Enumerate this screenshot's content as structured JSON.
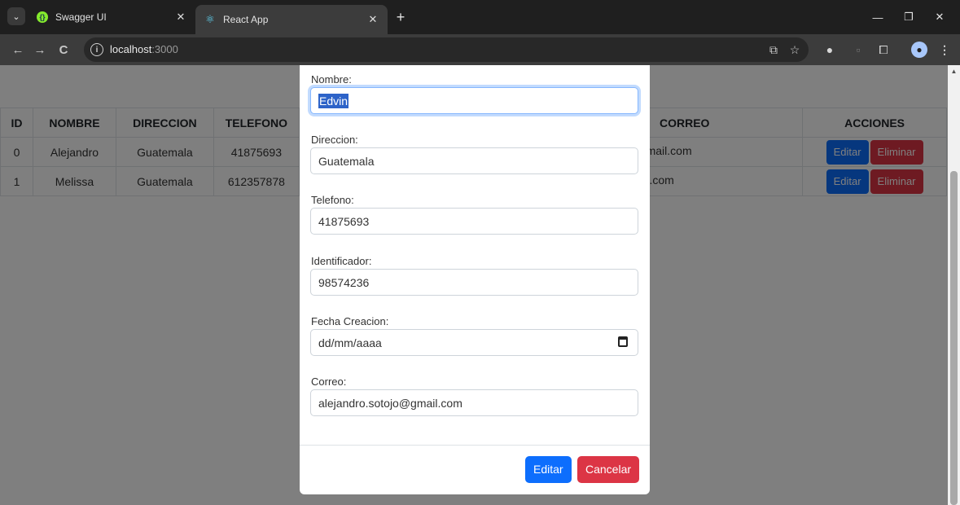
{
  "browser": {
    "tabs": [
      {
        "title": "Swagger UI",
        "icon": "swagger-icon",
        "active": false
      },
      {
        "title": "React App",
        "icon": "react-icon",
        "active": true
      }
    ],
    "url_host": "localhost",
    "url_port": ":3000"
  },
  "table": {
    "headers": [
      "ID",
      "NOMBRE",
      "DIRECCION",
      "TELEFONO",
      "",
      "CORREO",
      "ACCIONES"
    ],
    "rows": [
      {
        "id": "0",
        "nombre": "Alejandro",
        "direccion": "Guatemala",
        "telefono": "41875693",
        "correo": "ndro.sotojo@gmail.com"
      },
      {
        "id": "1",
        "nombre": "Melissa",
        "direccion": "Guatemala",
        "telefono": "612357878",
        "correo": "melissa@gmail.com"
      }
    ],
    "edit_label": "Editar",
    "delete_label": "Eliminar"
  },
  "modal": {
    "fields": [
      {
        "label": "Nombre:",
        "value": "Edvin"
      },
      {
        "label": "Direccion:",
        "value": "Guatemala"
      },
      {
        "label": "Telefono:",
        "value": "41875693"
      },
      {
        "label": "Identificador:",
        "value": "98574236"
      },
      {
        "label": "Fecha Creacion:",
        "value": "dd/mm/aaaa"
      },
      {
        "label": "Correo:",
        "value": "alejandro.sotojo@gmail.com"
      }
    ],
    "submit_label": "Editar",
    "cancel_label": "Cancelar"
  },
  "colors": {
    "primary": "#0d6efd",
    "danger": "#dc3545",
    "overlay": "rgba(0,0,0,0.5)"
  }
}
